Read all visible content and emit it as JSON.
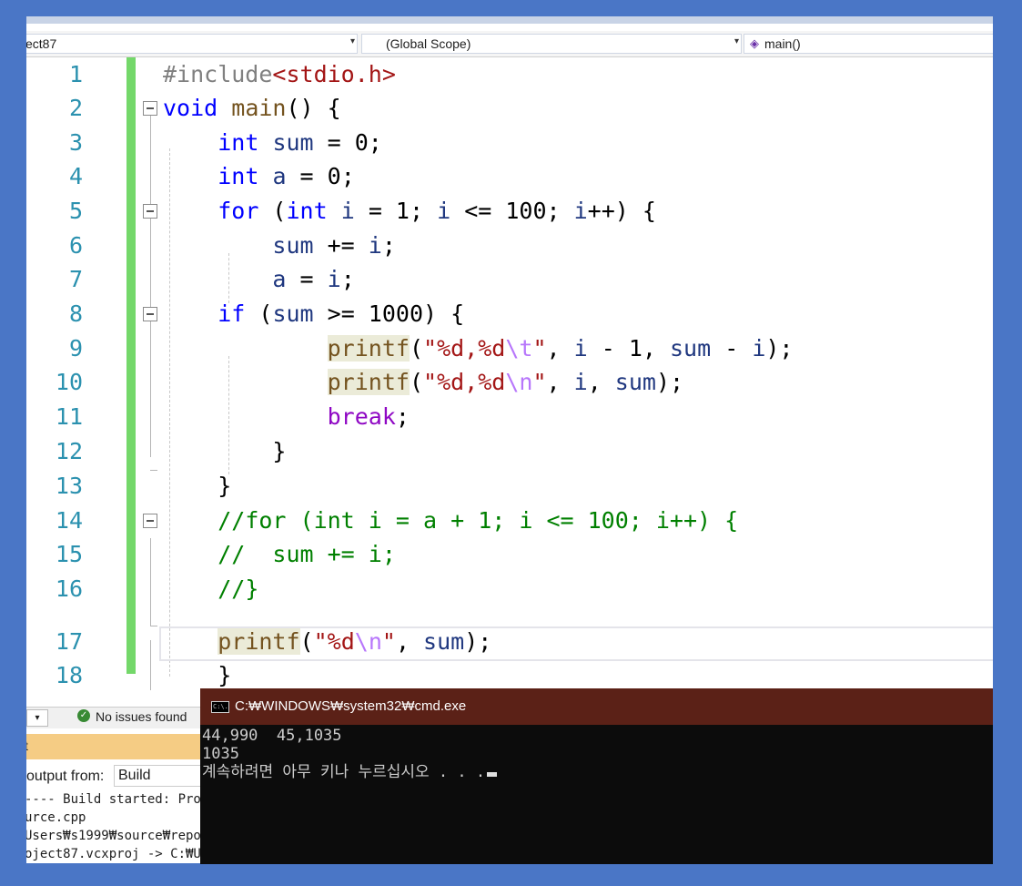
{
  "navbar": {
    "project": "ect87",
    "scope": "(Global Scope)",
    "function": "main()",
    "dropdown_arrow": "▾"
  },
  "editor": {
    "line_numbers": [
      "1",
      "2",
      "3",
      "4",
      "5",
      "6",
      "7",
      "8",
      "9",
      "10",
      "11",
      "12",
      "13",
      "14",
      "15",
      "16",
      "17",
      "18"
    ]
  },
  "status": {
    "issues": "No issues found"
  },
  "output": {
    "header": "t",
    "show_label": "output from:",
    "source": "Build",
    "lines": [
      "---- Build started: Projec",
      "urce.cpp",
      "Users₩s1999₩source₩repos",
      "oject87.vcxproj -> C:₩User"
    ]
  },
  "console": {
    "title": "C:₩WINDOWS₩system32₩cmd.exe",
    "icon_text": "C:\\.",
    "lines": [
      "44,990  45,1035",
      "1035",
      "계속하려면 아무 키나 누르십시오 . . ."
    ]
  }
}
